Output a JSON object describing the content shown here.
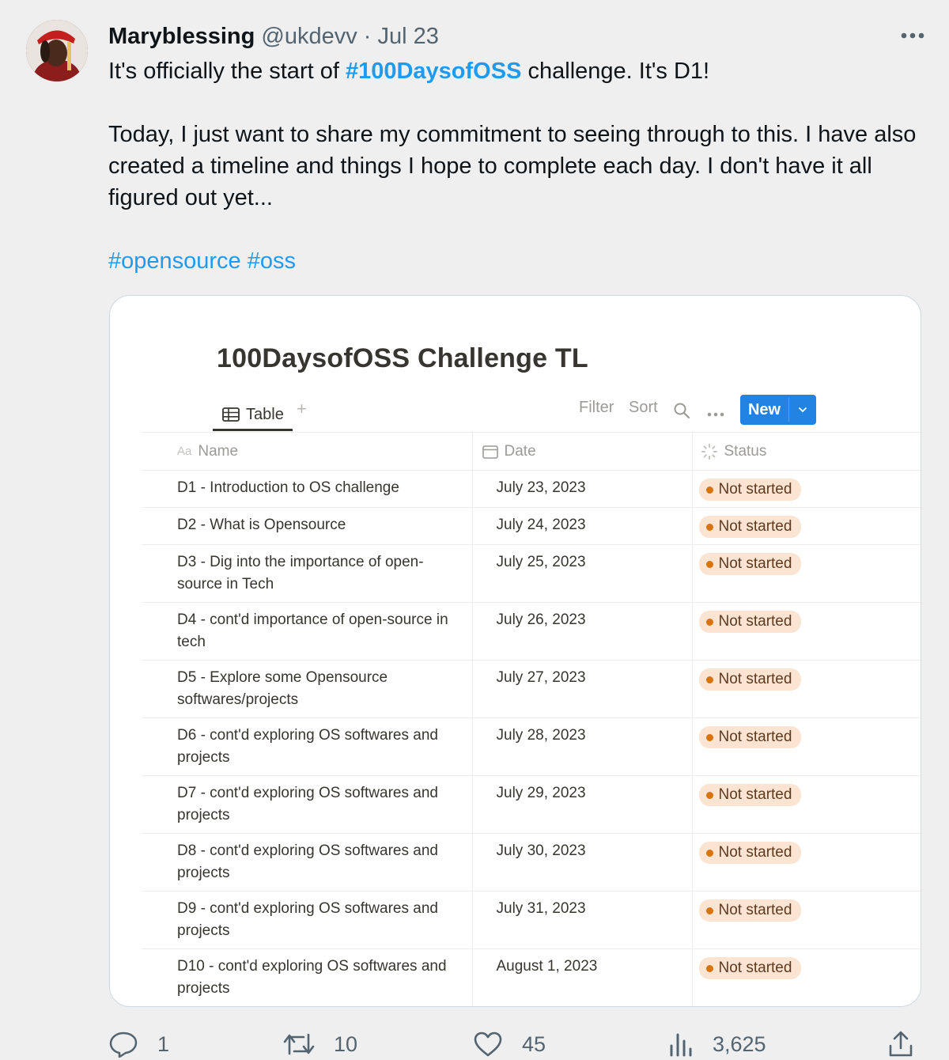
{
  "tweet": {
    "display_name": "Maryblessing",
    "handle": "@ukdevv",
    "separator": "·",
    "date": "Jul 23",
    "line1_prefix": "It's officially the start of",
    "line1_hashtag": "#100DaysofOSS",
    "line1_suffix": "challenge. It's D1!",
    "paragraph2": "Today, I just want to share my commitment to seeing through to this. I have also created a timeline and things I hope to complete each day.  I don't have it all figured out yet...",
    "hashtags": [
      "#opensource",
      "#oss"
    ]
  },
  "notion": {
    "title": "100DaysofOSS Challenge TL",
    "view_tab": "Table",
    "add_view": "+",
    "toolbar": {
      "filter": "Filter",
      "sort": "Sort",
      "new": "New"
    },
    "columns": {
      "name": "Name",
      "name_icon": "Aa",
      "date": "Date",
      "status": "Status"
    },
    "rows": [
      {
        "name": "D1 - Introduction to OS challenge",
        "date": "July 23, 2023",
        "status": "Not started"
      },
      {
        "name": "D2 - What is Opensource",
        "date": "July 24, 2023",
        "status": "Not started"
      },
      {
        "name": "D3 - Dig into the importance of open-source in Tech",
        "date": "July 25, 2023",
        "status": "Not started"
      },
      {
        "name": "D4 - cont'd importance of open-source in tech",
        "date": "July 26, 2023",
        "status": "Not started"
      },
      {
        "name": "D5 - Explore some Opensource softwares/projects",
        "date": "July 27, 2023",
        "status": "Not started"
      },
      {
        "name": "D6 - cont'd exploring OS softwares and projects",
        "date": "July 28, 2023",
        "status": "Not started"
      },
      {
        "name": "D7 - cont'd exploring OS softwares and projects",
        "date": "July 29, 2023",
        "status": "Not started"
      },
      {
        "name": "D8 - cont'd exploring OS softwares and projects",
        "date": "July 30, 2023",
        "status": "Not started"
      },
      {
        "name": "D9 - cont'd exploring OS softwares and projects",
        "date": "July 31, 2023",
        "status": "Not started"
      },
      {
        "name": "D10 - cont'd exploring OS softwares and projects",
        "date": "August 1, 2023",
        "status": "Not started"
      }
    ]
  },
  "actions": {
    "replies": "1",
    "retweets": "10",
    "likes": "45",
    "views": "3,625"
  },
  "colors": {
    "link": "#1d9bf0",
    "notion_blue": "#2383e2",
    "status_bg": "#fbe4d2",
    "status_dot": "#d9730d"
  },
  "icons": [
    "more-icon",
    "table-icon",
    "search-icon",
    "calendar-icon",
    "status-icon",
    "chevron-down-icon",
    "reply-icon",
    "retweet-icon",
    "like-icon",
    "views-icon",
    "share-icon"
  ]
}
